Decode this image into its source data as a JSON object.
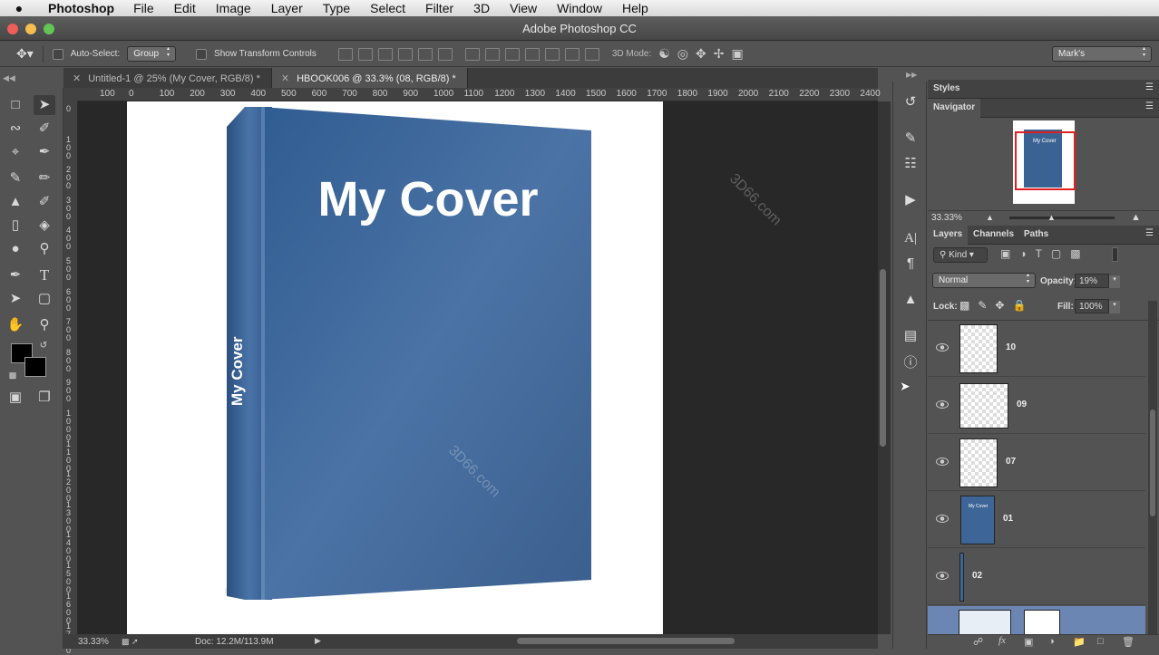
{
  "menubar": {
    "app": "Photoshop",
    "items": [
      "File",
      "Edit",
      "Image",
      "Layer",
      "Type",
      "Select",
      "Filter",
      "3D",
      "View",
      "Window",
      "Help"
    ]
  },
  "window": {
    "title": "Adobe Photoshop CC"
  },
  "options": {
    "auto_select_label": "Auto-Select:",
    "auto_select_value": "Group",
    "transform_label": "Show Transform Controls",
    "mode3d_label": "3D Mode:",
    "workspace": "Mark's"
  },
  "tabs": [
    {
      "label": "Untitled-1 @ 25% (My Cover, RGB/8) *"
    },
    {
      "label": "HBOOK006 @ 33.3% (08, RGB/8) *"
    }
  ],
  "ruler": {
    "h": [
      "100",
      "0",
      "100",
      "200",
      "300",
      "400",
      "500",
      "600",
      "700",
      "800",
      "900",
      "1000",
      "1100",
      "1200",
      "1300",
      "1400",
      "1500",
      "1600",
      "1700",
      "1800",
      "1900",
      "2000",
      "2100",
      "2200",
      "2300",
      "2400"
    ],
    "v": [
      "0",
      "100",
      "200",
      "300",
      "400",
      "500",
      "600",
      "700",
      "800",
      "900",
      "1000",
      "1100",
      "1200",
      "1300",
      "1400",
      "1500",
      "1600",
      "1700"
    ]
  },
  "document": {
    "cover_title": "My Cover",
    "spine_title": "My Cover",
    "cover_color": "#3a6394"
  },
  "status": {
    "zoom": "33.33%",
    "doc": "Doc: 12.2M/113.9M"
  },
  "panels": {
    "styles": "Styles",
    "navigator": "Navigator",
    "nav_zoom": "33.33%",
    "nav_thumb_text": "My Cover",
    "layers_tab": "Layers",
    "channels_tab": "Channels",
    "paths_tab": "Paths",
    "kind": "Kind",
    "blend": "Normal",
    "opacity_label": "Opacity:",
    "opacity": "19%",
    "lock_label": "Lock:",
    "fill_label": "Fill:",
    "fill": "100%"
  },
  "layers": [
    {
      "name": "10"
    },
    {
      "name": "09"
    },
    {
      "name": "07"
    },
    {
      "name": "01",
      "thumb_text": "My Cover"
    },
    {
      "name": "02"
    }
  ],
  "watermark": "3D66.com"
}
